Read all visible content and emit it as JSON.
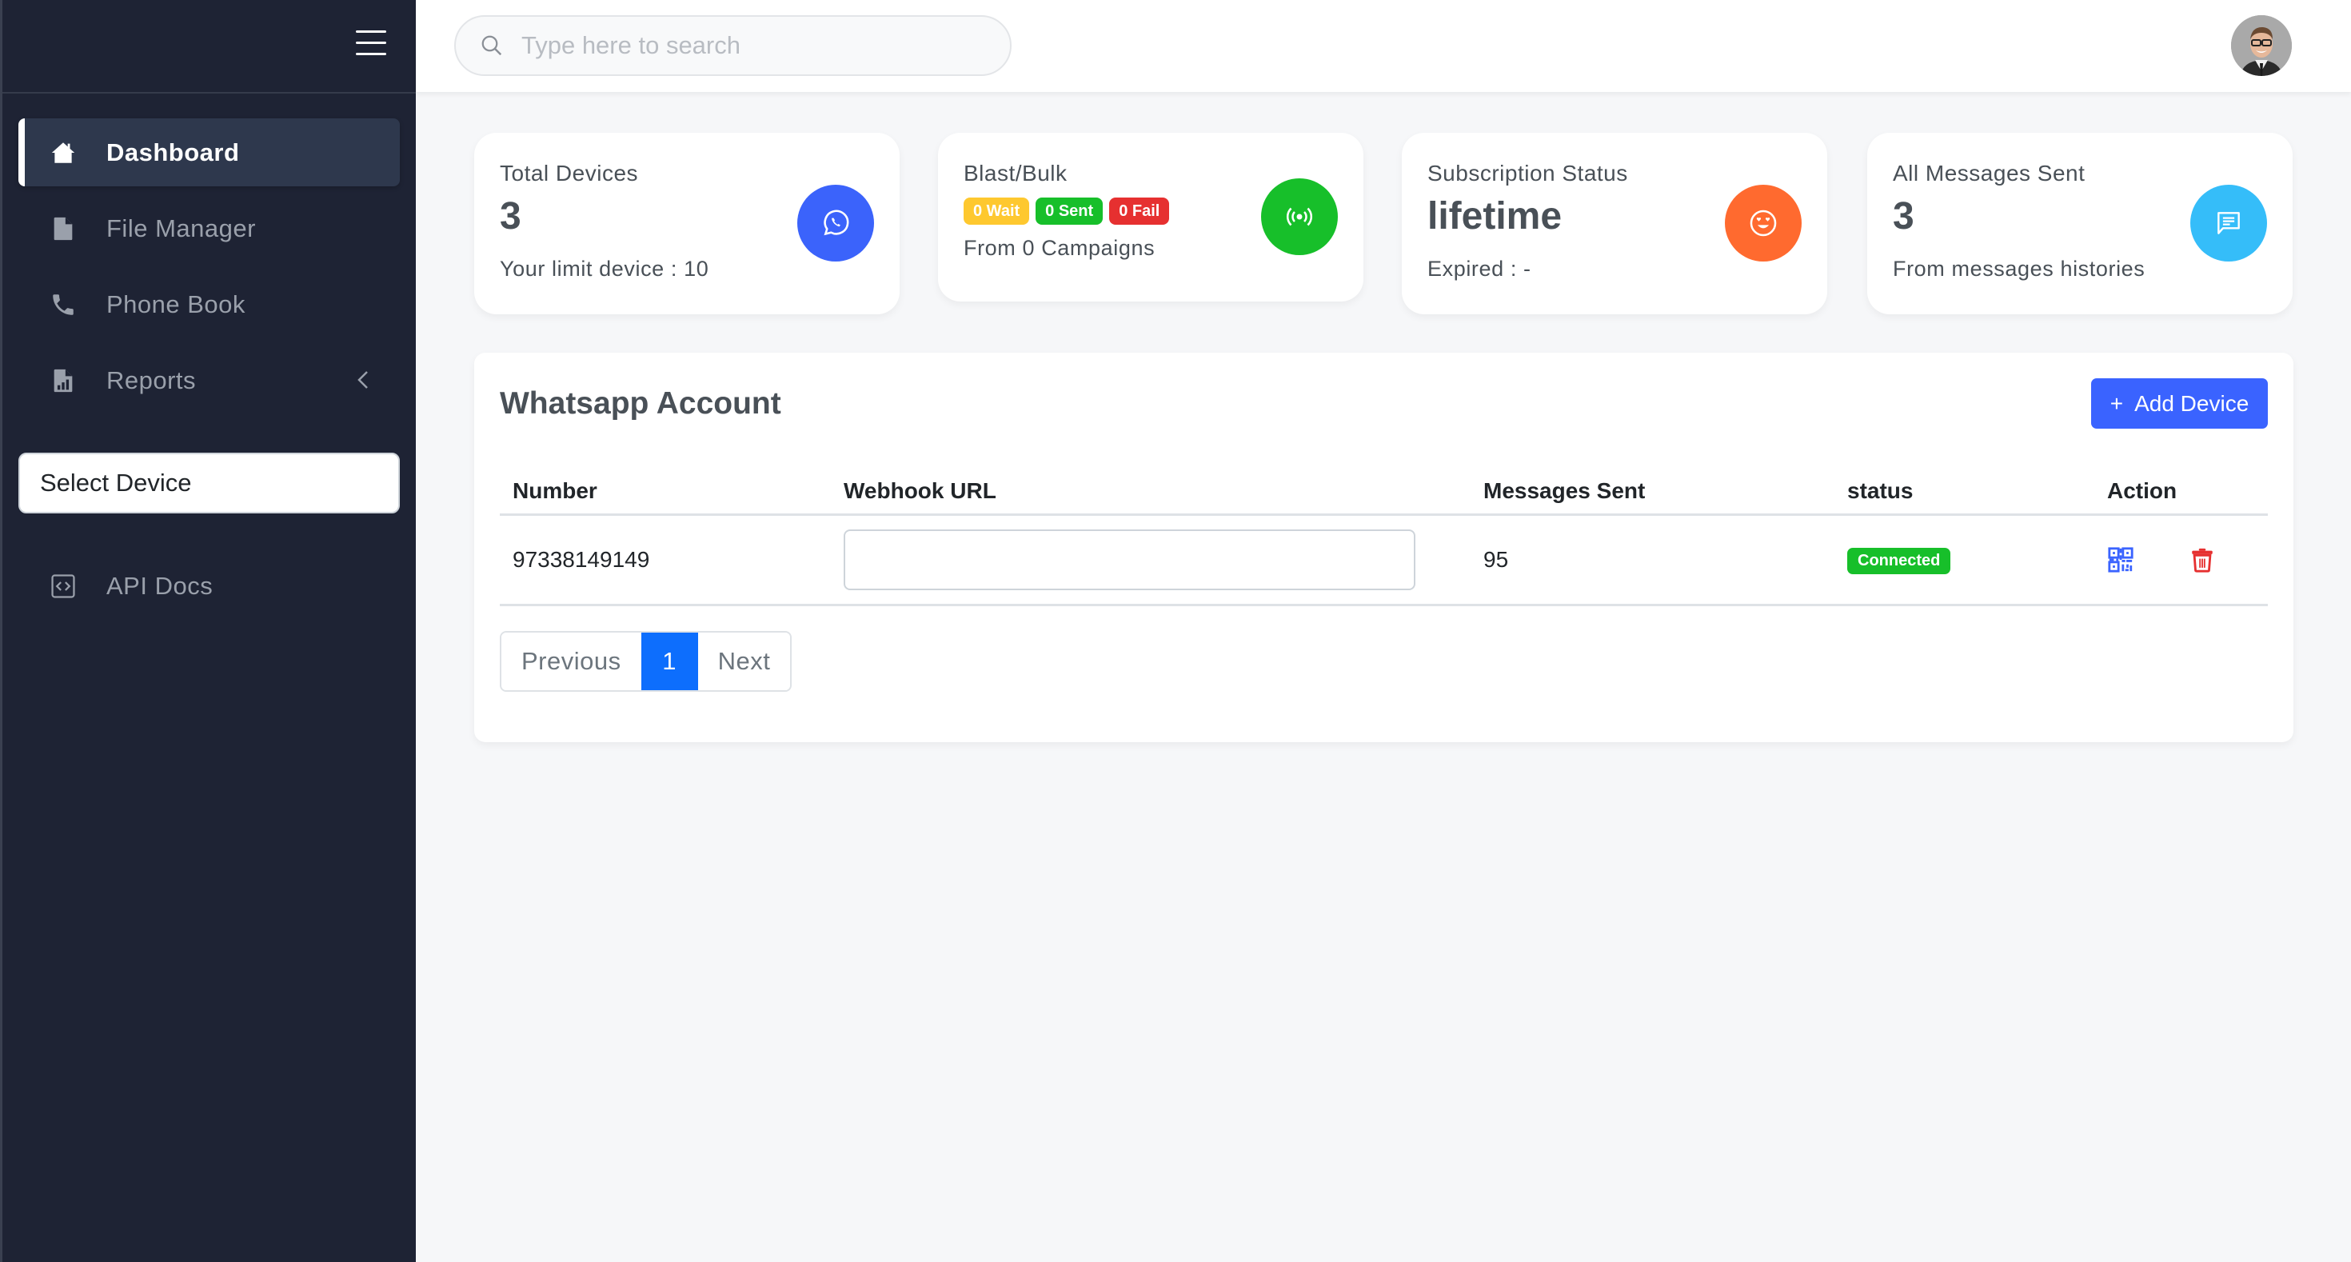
{
  "sidebar": {
    "menu_toggle_icon": "hamburger-icon",
    "items": [
      {
        "label": "Dashboard",
        "icon": "home-icon",
        "active": true
      },
      {
        "label": "File Manager",
        "icon": "file-icon",
        "active": false
      },
      {
        "label": "Phone Book",
        "icon": "phone-icon",
        "active": false
      },
      {
        "label": "Reports",
        "icon": "report-icon",
        "active": false,
        "has_submenu": true
      }
    ],
    "select_device": {
      "label": "Select Device"
    },
    "api_docs": {
      "label": "API Docs",
      "icon": "code-icon"
    }
  },
  "header": {
    "search": {
      "placeholder": "Type here to search",
      "value": ""
    },
    "avatar": "user-avatar"
  },
  "stats": [
    {
      "title": "Total Devices",
      "value": "3",
      "sub": "Your limit device : 10",
      "icon": "whatsapp-icon",
      "color": "#3b63fb"
    },
    {
      "title": "Blast/Bulk",
      "badges": [
        {
          "label": "0 Wait",
          "color": "#fec82f"
        },
        {
          "label": "0 Sent",
          "color": "#17bf2a"
        },
        {
          "label": "0 Fail",
          "color": "#e63030"
        }
      ],
      "sub": "From 0 Campaigns",
      "icon": "broadcast-icon",
      "color": "#17bf2a"
    },
    {
      "title": "Subscription Status",
      "value": "lifetime",
      "sub": "Expired : -",
      "icon": "smile-heart-eyes-icon",
      "color": "#ff6a2f"
    },
    {
      "title": "All Messages Sent",
      "value": "3",
      "sub": "From messages histories",
      "icon": "message-icon",
      "color": "#35bdf9"
    }
  ],
  "accounts": {
    "title": "Whatsapp Account",
    "add_button": "Add Device",
    "columns": [
      "Number",
      "Webhook URL",
      "Messages Sent",
      "status",
      "Action"
    ],
    "rows": [
      {
        "number": "97338149149",
        "webhook_url": "",
        "messages_sent": "95",
        "status": "Connected",
        "actions": [
          "qr-code-icon",
          "trash-icon"
        ]
      }
    ],
    "pagination": {
      "previous": "Previous",
      "current": "1",
      "next": "Next"
    }
  },
  "colors": {
    "sidebar_bg": "#1e2334",
    "accent_blue": "#3a63ff",
    "status_connected": "#17bf2a",
    "danger": "#e63030"
  }
}
